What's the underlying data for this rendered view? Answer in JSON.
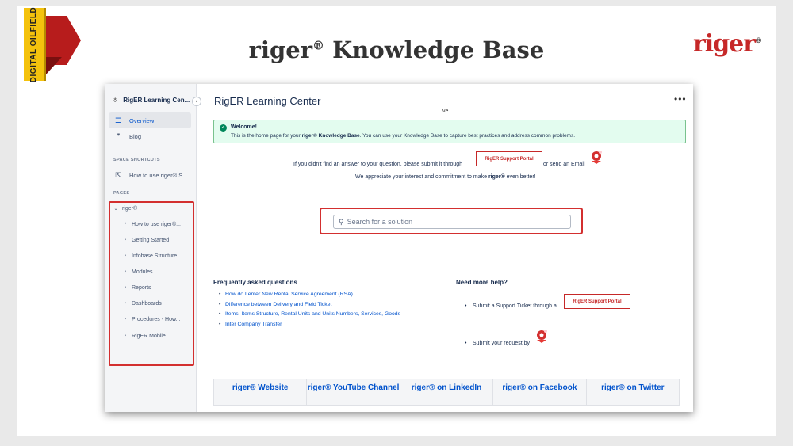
{
  "slide": {
    "banner_text": "DIGITAL OILFIELD",
    "headline": "riger",
    "headline_sup": "®",
    "headline_rest": " Knowledge Base",
    "logo_text": "riger",
    "logo_sup": "®"
  },
  "sidebar": {
    "space_name": "RigER Learning Cen...",
    "collapse_glyph": "‹",
    "nav": [
      {
        "label": "Overview",
        "icon": "list-lines-icon",
        "glyph": "☰",
        "active": true
      },
      {
        "label": "Blog",
        "icon": "quote-icon",
        "glyph": "❞",
        "active": false
      }
    ],
    "shortcuts_label": "SPACE SHORTCUTS",
    "shortcut": {
      "label": "How to use riger® S...",
      "icon": "external-link-icon",
      "glyph": "⇱"
    },
    "pages_label": "PAGES",
    "tree_root": {
      "label": "riger®",
      "glyph": "⌄"
    },
    "tree": [
      {
        "label": "How to use riger®...",
        "glyph": "•"
      },
      {
        "label": "Getting Started",
        "glyph": "›"
      },
      {
        "label": "Infobase Structure",
        "glyph": "›"
      },
      {
        "label": "Modules",
        "glyph": "›"
      },
      {
        "label": "Reports",
        "glyph": "›"
      },
      {
        "label": "Dashboards",
        "glyph": "›"
      },
      {
        "label": "Procedures - How...",
        "glyph": "›"
      },
      {
        "label": "RigER Mobile",
        "glyph": "›"
      }
    ]
  },
  "main": {
    "title": "RigER Learning Center",
    "more_glyph": "•••",
    "stray_text": "ve",
    "welcome": {
      "title": "Welcome!",
      "text_pre": "This is the home page for your ",
      "text_bold": "riger® Knowledge Base",
      "text_post": ". You can use your Knowledge Base to capture best practices and address common problems."
    },
    "support_line_pre": "If you didn't find an answer to your question, please submit it through",
    "support_line_post": "or send an Email",
    "portal_label": "RigER Support Portal",
    "appreciate_pre": "We appreciate your interest and commitment to make ",
    "appreciate_bold": "riger®",
    "appreciate_post": " even better!",
    "search": {
      "placeholder": "Search for a solution",
      "value": ""
    },
    "faq_title": "Frequently asked questions",
    "faq": [
      "How do I enter New Rental Service Agreement (RSA)",
      "Difference between Delivery and Field Ticket",
      "Items, Items Structure, Rental Units and Units Numbers, Services, Goods",
      "Inter Company Transfer"
    ],
    "help_title": "Need more help?",
    "help_ticket": "Submit a Support Ticket through a",
    "help_request": "Submit your request by",
    "footer": [
      {
        "text": "riger® Website"
      },
      {
        "text": "riger® YouTube Channel"
      },
      {
        "text": "riger® on LinkedIn"
      },
      {
        "text": "riger® on Facebook"
      },
      {
        "text": "riger® on Twitter"
      }
    ]
  },
  "colors": {
    "accent": "#0052cc",
    "brand_red": "#c62828",
    "success_bg": "#e3fcef"
  }
}
